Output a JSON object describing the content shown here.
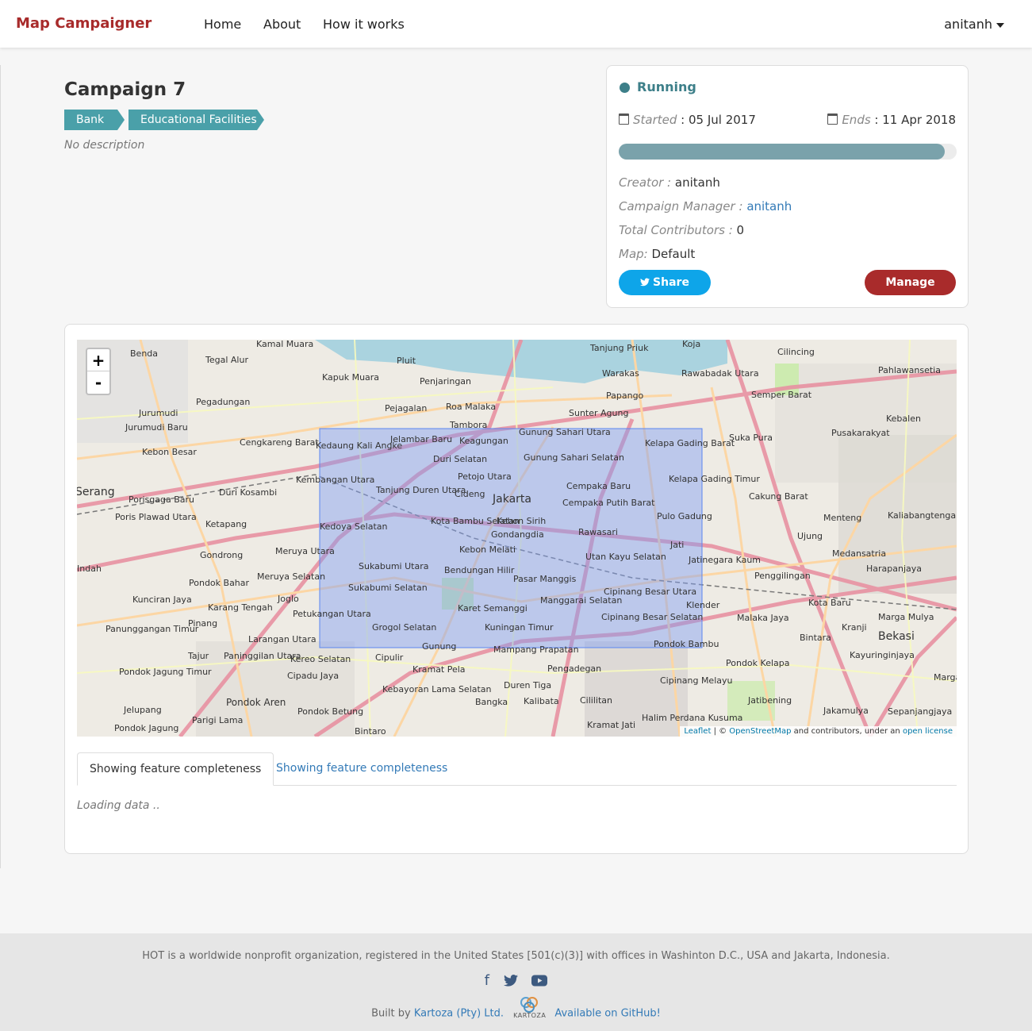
{
  "navbar": {
    "brand": "Map Campaigner",
    "links": [
      "Home",
      "About",
      "How it works"
    ],
    "user": "anitanh"
  },
  "campaign": {
    "title": "Campaign 7",
    "tags": [
      "Bank",
      "Educational Facilities"
    ],
    "description": "No description"
  },
  "status": {
    "state": "Running",
    "started_label": "Started",
    "started_value": "05 Jul 2017",
    "ends_label": "Ends",
    "ends_value": "11 Apr 2018",
    "progress_fraction": 0.965,
    "creator_label": "Creator :",
    "creator_value": "anitanh",
    "manager_label": "Campaign Manager :",
    "manager_value": "anitanh",
    "contributors_label": "Total Contributors :",
    "contributors_value": "0",
    "map_label": "Map:",
    "map_value": "Default",
    "share_label": "Share",
    "manage_label": "Manage",
    "accent": "#3d7f89"
  },
  "map": {
    "zoom_in": "+",
    "zoom_out": "-",
    "attribution": {
      "leaflet": "Leaflet",
      "sep": " | © ",
      "osm": "OpenStreetMap",
      "mid": " and contributors, under an ",
      "license": "open license"
    },
    "place_labels": [
      "Jakarta",
      "Kamal Muara",
      "Tanjung Priuk",
      "Koja",
      "Cilincing",
      "Pahlawansetia",
      "Benda",
      "Tegal Alur",
      "Pluit",
      "Kapuk Muara",
      "Penjaringan",
      "Warakas",
      "Rawabadak Utara",
      "Jurumudi",
      "Pegadungan",
      "Pejagalan",
      "Roa Malaka",
      "Papango",
      "Semper Barat",
      "Sunter Agung",
      "Kebalen",
      "Jurumudi Baru",
      "Tambora",
      "Gunung Sahari Utara",
      "Kelapa Gading Barat",
      "Suka Pura",
      "Pusakarakyat",
      "Cengkareng Barat",
      "Kedaung Kali Angke",
      "Jelambar Baru",
      "Keagungan",
      "Duri Selatan",
      "Gunung Sahari Selatan",
      "Kebon Besar",
      "Kembangan Utara",
      "Tanjung Duren Utara",
      "Petojo Utara",
      "Cempaka Baru",
      "Kelapa Gading Timur",
      "Duri Kosambi",
      "Porisgaga Baru",
      "Cideng",
      "Cempaka Putih Barat",
      "Cakung Barat",
      "Menteng",
      "Kaliabangtengah",
      "Poris Plawad Utara",
      "Ketapang",
      "Kedoya Selatan",
      "Kota Bambu Selatan",
      "Kebon Sirih",
      "Rawasari",
      "Pulo Gadung",
      "Ujung",
      "Gondangdia",
      "Kebon Melati",
      "Meruya Utara",
      "Jati",
      "Medansatria",
      "Gondrong",
      "Utan Kayu Selatan",
      "Jatinegara Kaum",
      "Harapanjaya",
      "Sukabumi Utara",
      "Bendungan Hilir",
      "Pasar Manggis",
      "Penggilingan",
      "Pondok Bahar",
      "Meruya Selatan",
      "Sukabumi Selatan",
      "Cipinang Besar Utara",
      "Kunciran Jaya",
      "Joglo",
      "Karet Semanggi",
      "Manggarai Selatan",
      "Klender",
      "Kota Baru",
      "Karang Tengah",
      "Petukangan Utara",
      "Malaka Jaya",
      "Marga Mulya",
      "Panunggangan Timur",
      "Pinang",
      "Grogol Selatan",
      "Kuningan Timur",
      "Cipinang Besar Selatan",
      "Bintara",
      "Kranji",
      "Bekasi",
      "Larangan Utara",
      "Gunung",
      "Mampang Prapatan",
      "Pondok Bambu",
      "Tajur",
      "Paninggilan Utara",
      "Kereo Selatan",
      "Cipulir",
      "Pengadegan",
      "Pondok Kelapa",
      "Kayuringinjaya",
      "Pondok Jagung Timur",
      "Cipadu Jaya",
      "Kramat Pela",
      "Cipinang Melayu",
      "Margahayu",
      "Kebayoran Lama Selatan",
      "Duren Tiga",
      "Pondok Aren",
      "Bangka",
      "Kalibata",
      "Cililitan",
      "Jatibening",
      "Jakamulya",
      "Sepanjangjaya",
      "Jelupang",
      "Pondok Betung",
      "Parigi Lama",
      "Halim Perdana Kusuma",
      "Kramat Jati",
      "Pondok Jagung",
      "Bintaro",
      "Serang",
      "Indah"
    ]
  },
  "tabs": [
    "Showing feature completeness",
    "Showing feature completeness"
  ],
  "loading_text": "Loading data ..",
  "footer": {
    "text": "HOT is a worldwide nonprofit organization, registered in the United States [501(c)(3)] with offices in Washinton D.C., USA and Jakarta, Indonesia.",
    "social": [
      "facebook-icon",
      "twitter-icon",
      "youtube-icon"
    ],
    "built_by": "Built by",
    "kartoza_link": "Kartoza (Pty) Ltd.",
    "kartoza_logo_text": "KARTOZA",
    "github_link": "Available on GitHub!"
  }
}
